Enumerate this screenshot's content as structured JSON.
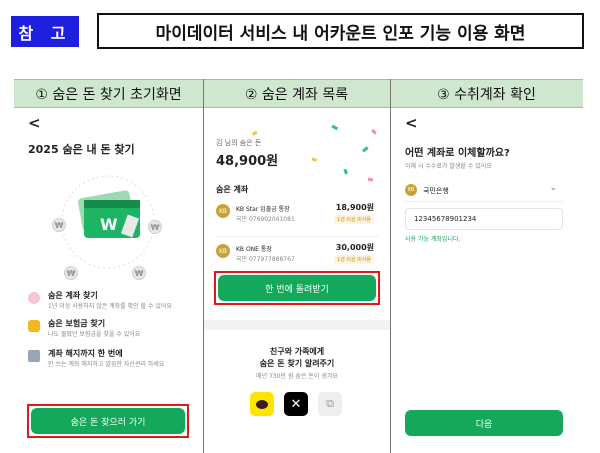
{
  "header": {
    "badge": "참 고",
    "title": "마이데이터 서비스 내 어카운트 인포 기능 이용 화면"
  },
  "columns": [
    {
      "heading": "① 숨은 돈 찾기 초기화면"
    },
    {
      "heading": "② 숨은 계좌 목록"
    },
    {
      "heading": "③ 수취계좌 확인"
    }
  ],
  "screen1": {
    "back": "<",
    "title": "2025 숨은 내 돈 찾기",
    "coin_glyph": "₩",
    "features": [
      {
        "title": "숨은 계좌 찾기",
        "desc": "1년 이상 사용하지 않은 계좌를 확인 할 수 있어요"
      },
      {
        "title": "숨은 보험금 찾기",
        "desc": "나도 몰랐던 보험금을 찾을 수 있어요"
      },
      {
        "title": "계좌 해지까지 한 번에",
        "desc": "안 쓰는 계좌 해지하고 깔끔한 자산관리 하세요"
      }
    ],
    "cta": "숨은 돈 찾으러 가기"
  },
  "screen2": {
    "owner_label": "김 님의 숨은 돈",
    "total": "48,900원",
    "section": "숨은 계좌",
    "accounts": [
      {
        "name": "KB Star 입출금 통장",
        "number": "국민 076902041081",
        "amount": "18,900원",
        "tag": "1년 이상 미사용"
      },
      {
        "name": "KB ONE 통장",
        "number": "국민 077977888767",
        "amount": "30,000원",
        "tag": "1년 이상 미사용"
      }
    ],
    "cta": "한 번에 돌려받기",
    "share_title_1": "친구와 가족에게",
    "share_title_2": "숨은 돈 찾기 알려주기",
    "share_sub": "매년 730만 원 숨은 돈이 생겨요",
    "share_icons": [
      "kakaotalk-icon",
      "x-icon",
      "link-icon"
    ]
  },
  "screen3": {
    "back": "<",
    "question": "어떤 계좌로 이체할까요?",
    "sub": "이체 시 수수료가 발생할 수 있어요",
    "bank": "국민은행",
    "account_number": "12345678901234",
    "hint": "사용 가능 계좌입니다.",
    "cta": "다음"
  },
  "colors": {
    "accent_green": "#13a85a",
    "highlight_red": "#e0191b",
    "badge_blue": "#1f1fe0",
    "head_green": "#cfe7cf"
  }
}
